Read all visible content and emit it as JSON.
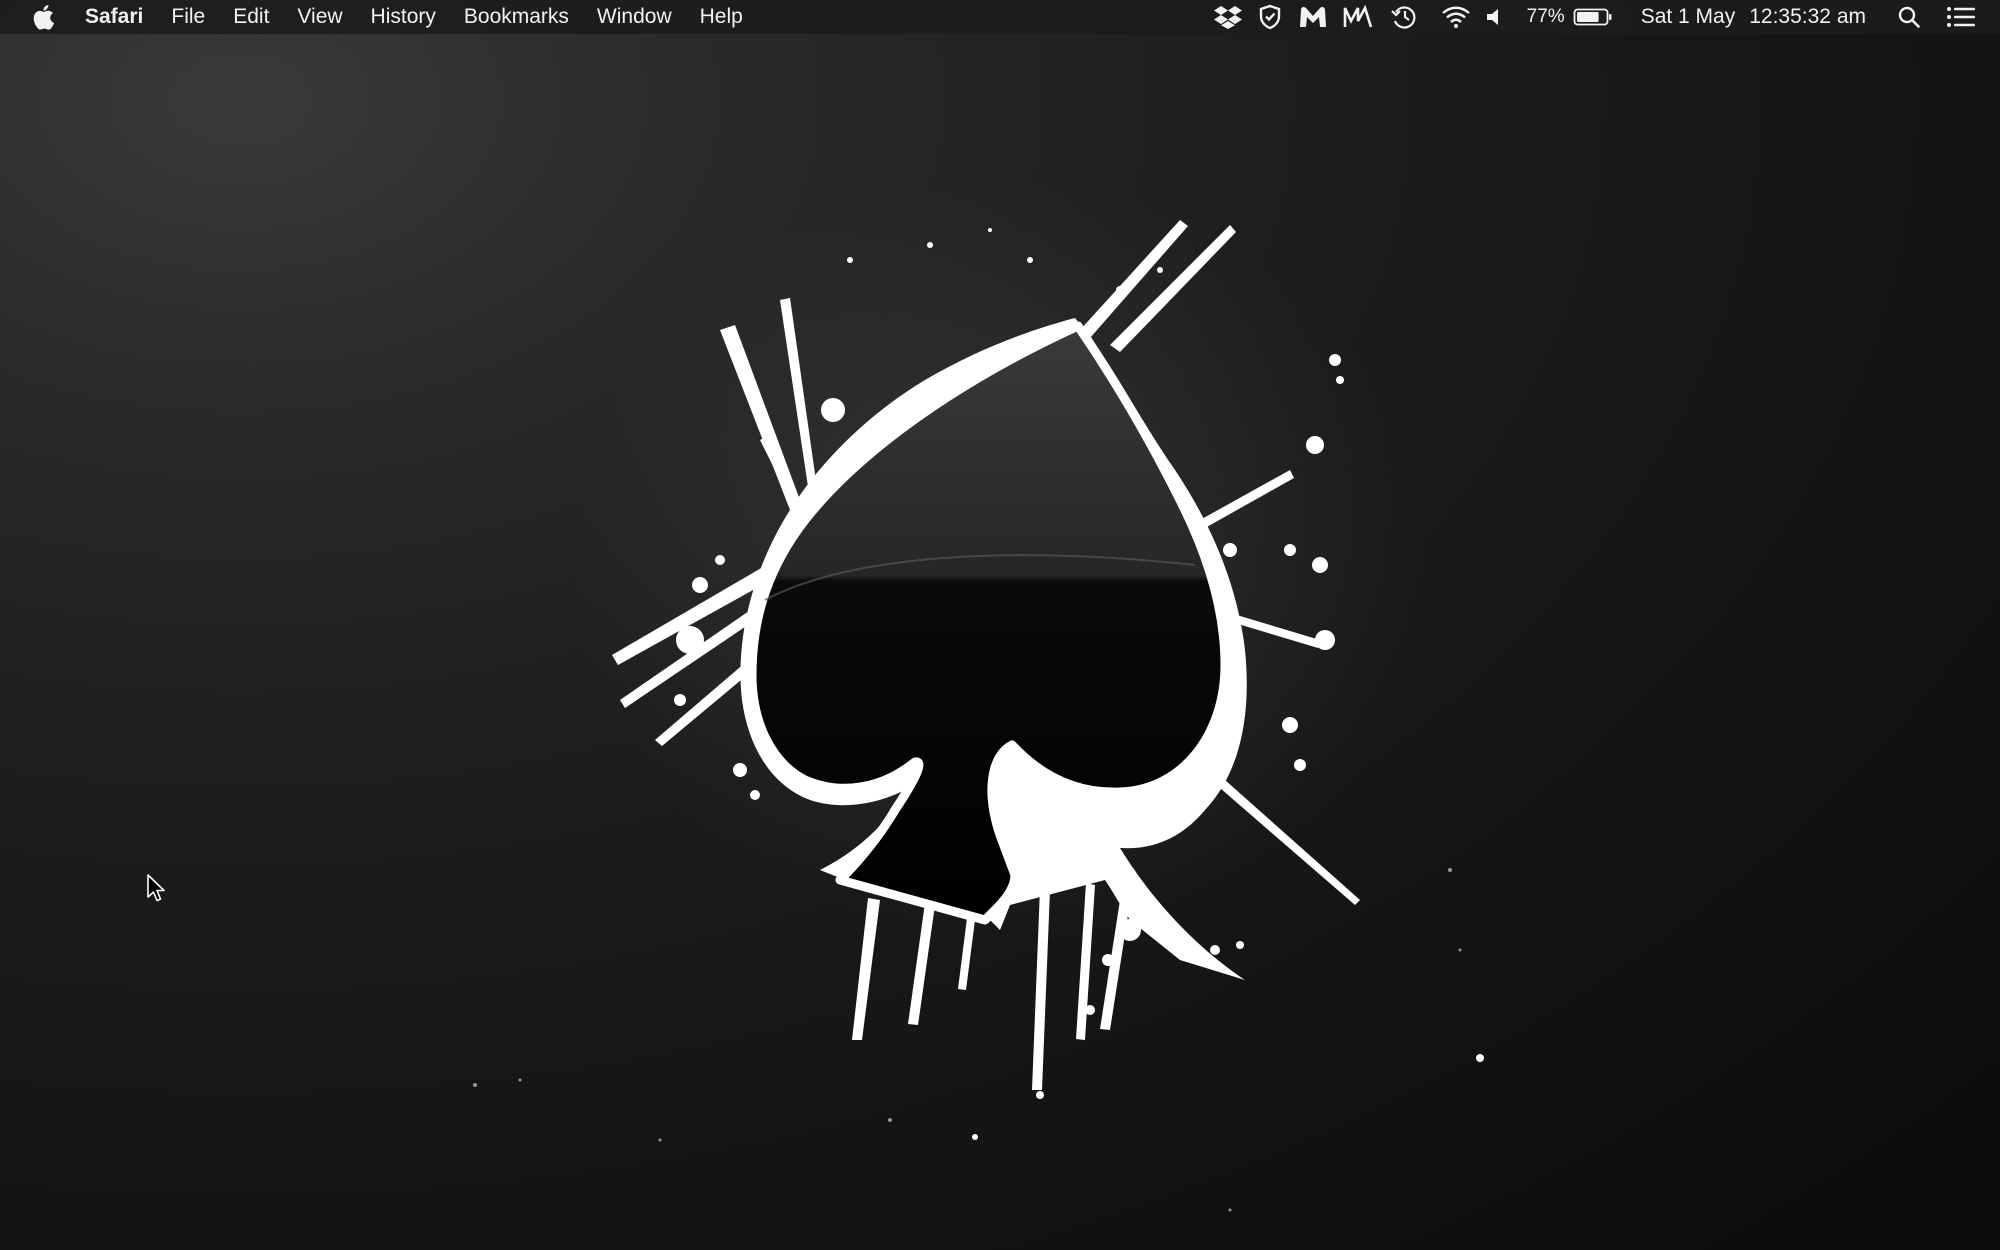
{
  "menubar": {
    "apple_icon": "apple-logo-icon",
    "app_name": "Safari",
    "items": [
      {
        "label": "File"
      },
      {
        "label": "Edit"
      },
      {
        "label": "View"
      },
      {
        "label": "History"
      },
      {
        "label": "Bookmarks"
      },
      {
        "label": "Window"
      },
      {
        "label": "Help"
      }
    ]
  },
  "status": {
    "icons": [
      "dropbox-icon",
      "shield-icon",
      "malwarebytes-icon",
      "m-app-icon",
      "time-machine-icon",
      "wifi-icon",
      "volume-icon"
    ],
    "battery_percent": "77%",
    "battery_level": 0.77,
    "date": "Sat 1 May",
    "time": "12:35:32 am",
    "right_icons": [
      "spotlight-search-icon",
      "notification-center-icon"
    ]
  },
  "wallpaper": {
    "subject": "spade-icon",
    "colors": {
      "background": "#151515",
      "splash": "#ffffff",
      "spade": "#000000"
    }
  }
}
